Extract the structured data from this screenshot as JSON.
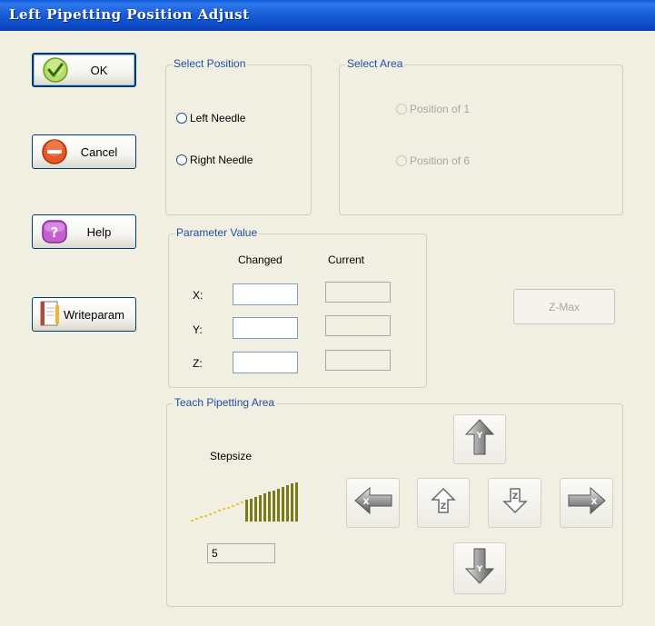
{
  "window": {
    "title": "Left Pipetting Position Adjust"
  },
  "buttons": {
    "ok": "OK",
    "cancel": "Cancel",
    "help": "Help",
    "writeparam": "Writeparam"
  },
  "select_position": {
    "title": "Select Position",
    "options": [
      "Left Needle",
      "Right Needle"
    ]
  },
  "select_area": {
    "title": "Select Area",
    "options": [
      "Position of 1",
      "Position of 6"
    ]
  },
  "parameter_value": {
    "title": "Parameter Value",
    "col_changed": "Changed",
    "col_current": "Current",
    "rows": [
      {
        "axis": "X:",
        "changed": "",
        "current": ""
      },
      {
        "axis": "Y:",
        "changed": "",
        "current": ""
      },
      {
        "axis": "Z:",
        "changed": "",
        "current": ""
      }
    ]
  },
  "zmax": {
    "label": "Z-Max"
  },
  "teach": {
    "title": "Teach Pipetting Area",
    "stepsize_label": "Stepsize",
    "stepsize_value": "5",
    "stepsize_level_fraction": 0.5,
    "arrow_buttons": [
      "y-up-icon",
      "x-left-icon",
      "z-up-icon",
      "z-down-icon",
      "x-right-icon",
      "y-down-icon"
    ]
  },
  "colors": {
    "title_bar": "#0a57d6",
    "group_title": "#1f4fa3",
    "step_bar_active": "#7a7a1a",
    "step_bar_inactive": "#e8c840"
  }
}
